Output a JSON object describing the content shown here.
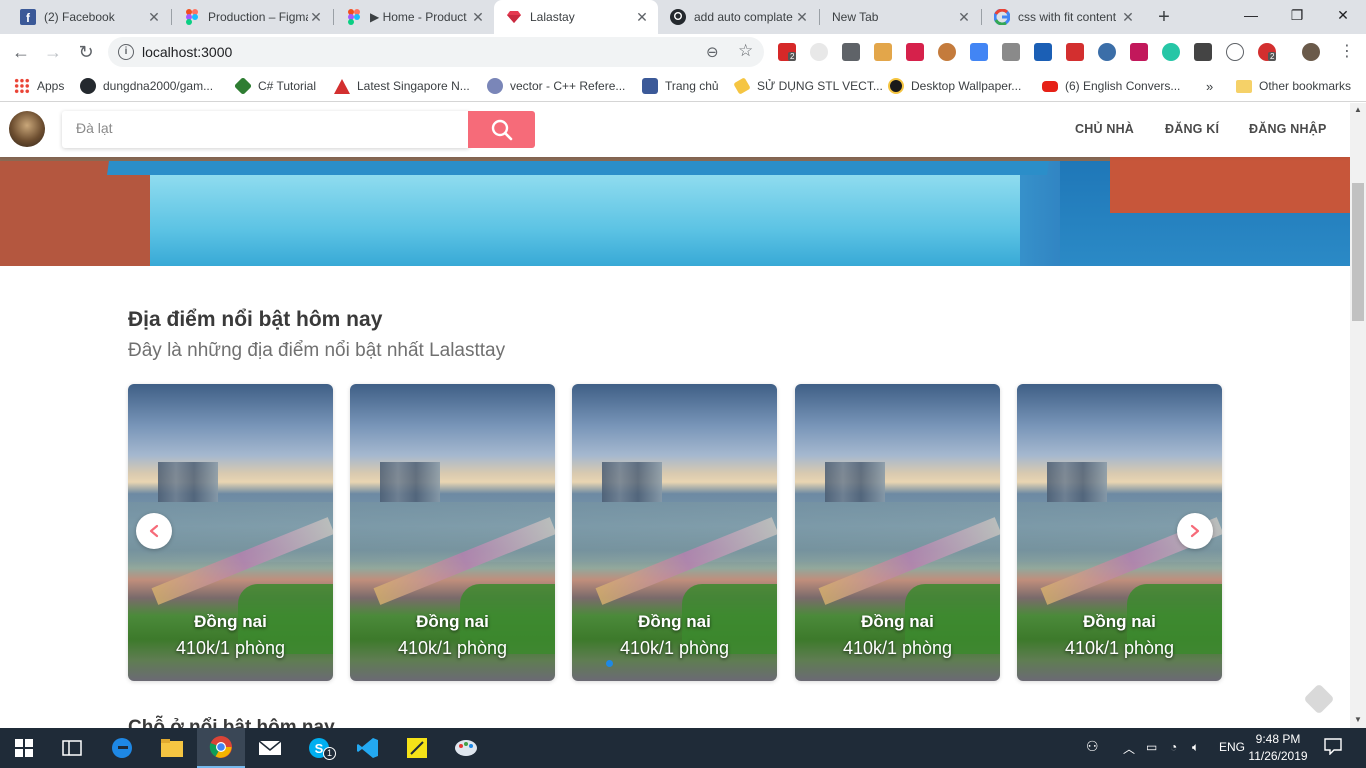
{
  "browser": {
    "tabs": [
      {
        "title": "(2) Facebook",
        "icon": "facebook-icon",
        "color": "#3b5998",
        "active": false
      },
      {
        "title": "Production – Figma",
        "icon": "figma-icon",
        "color": "#f24e1e",
        "active": false
      },
      {
        "title": "▶ Home - Product",
        "icon": "figma-icon",
        "color": "#a259ff",
        "active": false
      },
      {
        "title": "Lalastay",
        "icon": "heart-gem-icon",
        "color": "#e53950",
        "active": true
      },
      {
        "title": "add auto complate",
        "icon": "github-icon",
        "color": "#24292e",
        "active": false
      },
      {
        "title": "New Tab",
        "icon": "",
        "color": "",
        "active": false
      },
      {
        "title": "css with fit content",
        "icon": "google-icon",
        "color": "#4285f4",
        "active": false
      }
    ],
    "url": "localhost:3000",
    "bookmarks": [
      {
        "label": "Apps",
        "icon": "apps-grid-icon"
      },
      {
        "label": "dungdna2000/gam...",
        "icon": "github-icon"
      },
      {
        "label": "C# Tutorial",
        "icon": "csharp-icon"
      },
      {
        "label": "Latest Singapore N...",
        "icon": "triangle-icon"
      },
      {
        "label": "vector - C++ Refere...",
        "icon": "cpp-icon"
      },
      {
        "label": "Trang chủ",
        "icon": "facebook-icon"
      },
      {
        "label": "SỬ DỤNG STL VECT...",
        "icon": "bookmark-icon"
      },
      {
        "label": "Desktop Wallpaper...",
        "icon": "wallpaper-icon"
      },
      {
        "label": "(6) English Convers...",
        "icon": "youtube-icon"
      }
    ],
    "bookmarks_more": "»",
    "other_bookmarks": "Other bookmarks",
    "extension_badge_1": "2",
    "extension_badge_2": "2"
  },
  "site": {
    "search_placeholder": "Đà lạt",
    "nav": [
      "CHỦ NHÀ",
      "ĐĂNG KÍ",
      "ĐĂNG NHẬP"
    ],
    "section_title": "Địa điểm nổi bật hôm nay",
    "section_subtitle": "Đây là những địa điểm nổi bật nhất Lalasttay",
    "cards": [
      {
        "name": "Đồng nai",
        "price": "410k/1 phòng"
      },
      {
        "name": "Đồng nai",
        "price": "410k/1 phòng"
      },
      {
        "name": "Đồng nai",
        "price": "410k/1 phòng"
      },
      {
        "name": "Đồng nai",
        "price": "410k/1 phòng"
      },
      {
        "name": "Đồng nai",
        "price": "410k/1 phòng"
      }
    ],
    "next_section_title": "Chỗ ở nổi bật hôm nay",
    "accent_color": "#f66b79"
  },
  "taskbar": {
    "language": "ENG",
    "time": "9:48 PM",
    "date": "11/26/2019",
    "skype_badge": "1"
  }
}
